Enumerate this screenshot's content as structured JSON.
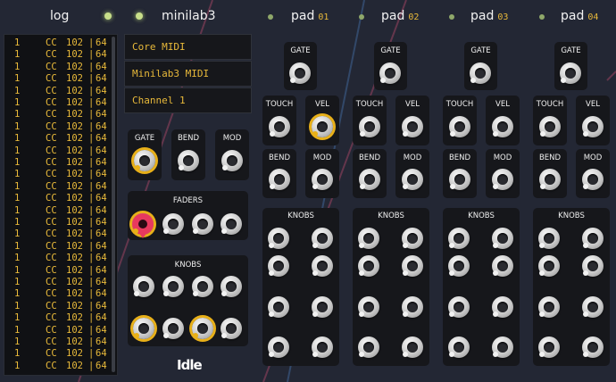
{
  "header": {
    "log_title": "log",
    "device_title": "minilab3",
    "pads": [
      {
        "label": "pad",
        "num": "01"
      },
      {
        "label": "pad",
        "num": "02"
      },
      {
        "label": "pad",
        "num": "03"
      },
      {
        "label": "pad",
        "num": "04"
      }
    ]
  },
  "log": {
    "rows": [
      {
        "ch": "1",
        "type": "CC",
        "num": "102",
        "val": "64"
      },
      {
        "ch": "1",
        "type": "CC",
        "num": "102",
        "val": "64"
      },
      {
        "ch": "1",
        "type": "CC",
        "num": "102",
        "val": "64"
      },
      {
        "ch": "1",
        "type": "CC",
        "num": "102",
        "val": "64"
      },
      {
        "ch": "1",
        "type": "CC",
        "num": "102",
        "val": "64"
      },
      {
        "ch": "1",
        "type": "CC",
        "num": "102",
        "val": "64"
      },
      {
        "ch": "1",
        "type": "CC",
        "num": "102",
        "val": "64"
      },
      {
        "ch": "1",
        "type": "CC",
        "num": "102",
        "val": "64"
      },
      {
        "ch": "1",
        "type": "CC",
        "num": "102",
        "val": "64"
      },
      {
        "ch": "1",
        "type": "CC",
        "num": "102",
        "val": "64"
      },
      {
        "ch": "1",
        "type": "CC",
        "num": "102",
        "val": "64"
      },
      {
        "ch": "1",
        "type": "CC",
        "num": "102",
        "val": "64"
      },
      {
        "ch": "1",
        "type": "CC",
        "num": "102",
        "val": "64"
      },
      {
        "ch": "1",
        "type": "CC",
        "num": "102",
        "val": "64"
      },
      {
        "ch": "1",
        "type": "CC",
        "num": "102",
        "val": "64"
      },
      {
        "ch": "1",
        "type": "CC",
        "num": "102",
        "val": "64"
      },
      {
        "ch": "1",
        "type": "CC",
        "num": "102",
        "val": "64"
      },
      {
        "ch": "1",
        "type": "CC",
        "num": "102",
        "val": "64"
      },
      {
        "ch": "1",
        "type": "CC",
        "num": "102",
        "val": "64"
      },
      {
        "ch": "1",
        "type": "CC",
        "num": "102",
        "val": "64"
      },
      {
        "ch": "1",
        "type": "CC",
        "num": "102",
        "val": "64"
      },
      {
        "ch": "1",
        "type": "CC",
        "num": "102",
        "val": "64"
      },
      {
        "ch": "1",
        "type": "CC",
        "num": "102",
        "val": "64"
      },
      {
        "ch": "1",
        "type": "CC",
        "num": "102",
        "val": "64"
      },
      {
        "ch": "1",
        "type": "CC",
        "num": "102",
        "val": "64"
      },
      {
        "ch": "1",
        "type": "CC",
        "num": "102",
        "val": "64"
      },
      {
        "ch": "1",
        "type": "CC",
        "num": "102",
        "val": "64"
      },
      {
        "ch": "1",
        "type": "CC",
        "num": "102",
        "val": "64"
      }
    ]
  },
  "midi": {
    "driver": "Core MIDI",
    "device": "Minilab3 MIDI",
    "channel": "Channel 1"
  },
  "minilab": {
    "gate_label": "GATE",
    "bend_label": "BEND",
    "mod_label": "MOD",
    "faders_label": "FADERS",
    "knobs_label": "KNOBS"
  },
  "pad_labels": {
    "gate": "GATE",
    "touch": "TOUCH",
    "vel": "VEL",
    "bend": "BEND",
    "mod": "MOD",
    "knobs": "KNOBS"
  },
  "logo": "Idle",
  "colors": {
    "background": "#232734",
    "panel": "#16171b",
    "accent": "#e8b93a",
    "active_ring": "#e8b019",
    "cable_red": "#e8395e",
    "led": "#c8df8a"
  }
}
